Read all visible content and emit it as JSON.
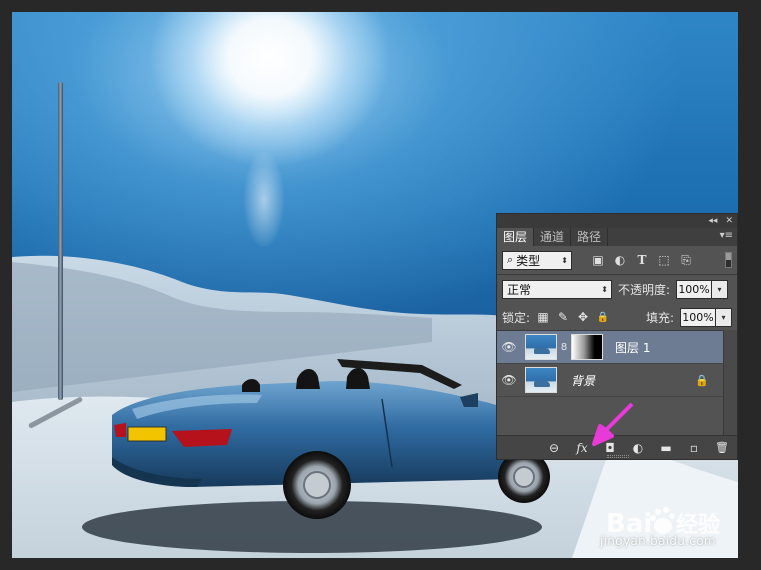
{
  "colors": {
    "panel_bg": "#535353",
    "selected_layer": "#6d7c93",
    "annotation_arrow": "#e83ad8"
  },
  "panel": {
    "top_icons": [
      "collapse-icon",
      "close-icon"
    ],
    "top_glyphs": {
      "collapse": "◂◂",
      "close": "✕"
    },
    "tabs": [
      {
        "label": "图层",
        "active": true
      },
      {
        "label": "通道",
        "active": false
      },
      {
        "label": "路径",
        "active": false
      }
    ],
    "menu_glyph": "▾≡",
    "filter": {
      "search_glyph": "⌕",
      "kind_label": "类型",
      "icons": [
        "image-filter-icon",
        "adjustment-filter-icon",
        "type-filter-icon",
        "shape-filter-icon",
        "smart-object-filter-icon"
      ],
      "glyphs": {
        "image": "▣",
        "adjust": "◐",
        "type": "T",
        "shape": "⬚",
        "smart": "⎘"
      }
    },
    "blend": {
      "mode": "正常",
      "opacity_label": "不透明度:",
      "opacity_value": "100%"
    },
    "lock": {
      "label": "锁定:",
      "icons": [
        "lock-transparent-icon",
        "lock-paint-icon",
        "lock-position-icon",
        "lock-all-icon"
      ],
      "glyphs": {
        "transparent": "▦",
        "paint": "✎",
        "position": "✥",
        "all": "🔒"
      },
      "fill_label": "填充:",
      "fill_value": "100%"
    },
    "layers": [
      {
        "name": "图层 1",
        "selected": true,
        "has_mask": true,
        "locked": false
      },
      {
        "name": "背景",
        "selected": false,
        "has_mask": false,
        "locked": true
      }
    ],
    "eye_glyph": "👁",
    "lock_glyph": "🔒",
    "chain_glyph": "8",
    "bottom_icons": [
      "link-layers-icon",
      "fx-icon",
      "add-mask-icon",
      "adjustment-layer-icon",
      "group-folder-icon",
      "new-layer-icon",
      "delete-icon"
    ],
    "bottom_glyphs": {
      "link": "⊖",
      "fx": "fx",
      "mask": "◘",
      "adjust": "◐",
      "folder": "▬",
      "new": "▫",
      "delete": "🗑"
    }
  },
  "watermark": {
    "logo_text": "Bai",
    "logo_text2": "du",
    "logo_cn": "经验",
    "url": "jingyan.baidu.com"
  }
}
